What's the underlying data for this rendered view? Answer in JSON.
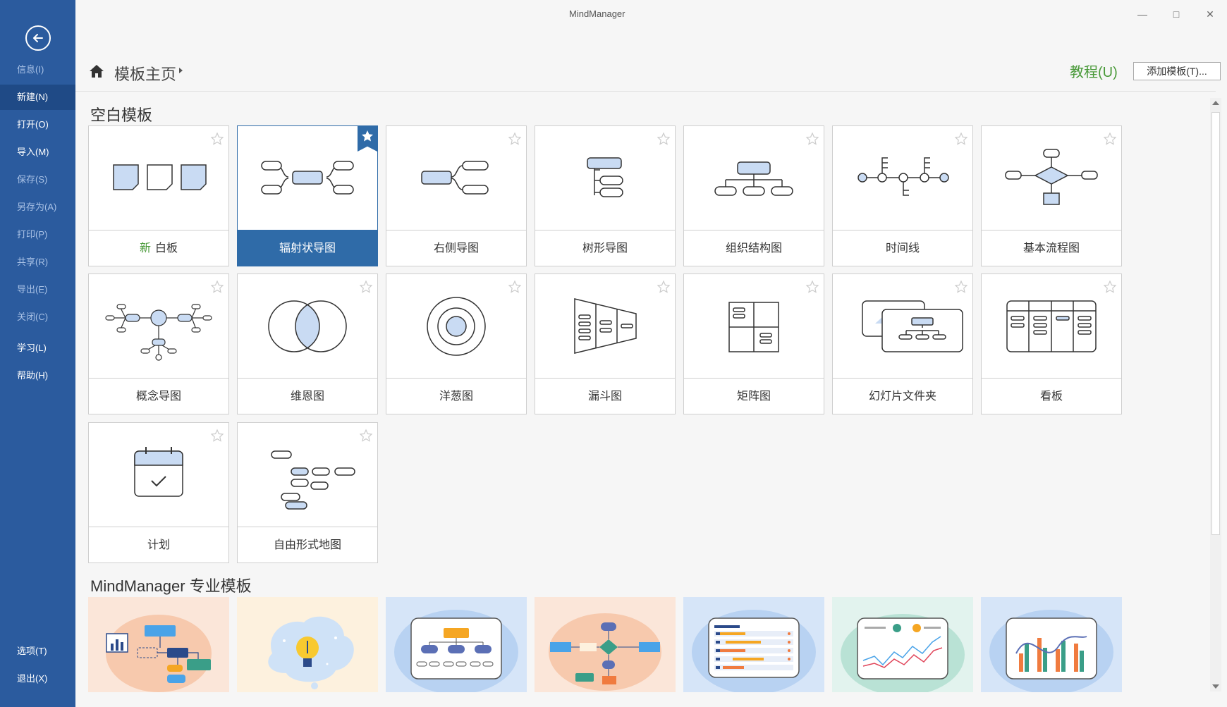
{
  "window": {
    "title": "MindManager",
    "minimize": "—",
    "maximize": "□",
    "close": "✕"
  },
  "sidebar": {
    "back_icon": "arrow-left-circle-icon",
    "items": [
      {
        "label": "信息(I)"
      },
      {
        "label": "新建(N)"
      },
      {
        "label": "打开(O)"
      },
      {
        "label": "导入(M)"
      },
      {
        "label": "保存(S)"
      },
      {
        "label": "另存为(A)"
      },
      {
        "label": "打印(P)"
      },
      {
        "label": "共享(R)"
      },
      {
        "label": "导出(E)"
      },
      {
        "label": "关闭(C)"
      },
      {
        "label": "学习(L)"
      },
      {
        "label": "帮助(H)"
      }
    ],
    "bottom_items": [
      {
        "label": "选项(T)"
      },
      {
        "label": "退出(X)"
      }
    ]
  },
  "header": {
    "home_icon": "home-icon",
    "breadcrumb": "模板主页",
    "tutorial": "教程(U)",
    "add_template": "添加模板(T)..."
  },
  "blank_templates": {
    "title": "空白模板",
    "new_tag": "新",
    "items": [
      {
        "label": "白板",
        "icon": "whiteboard-icon"
      },
      {
        "label": "辐射状导图",
        "icon": "radial-map-icon"
      },
      {
        "label": "右侧导图",
        "icon": "right-map-icon"
      },
      {
        "label": "树形导图",
        "icon": "tree-map-icon"
      },
      {
        "label": "组织结构图",
        "icon": "org-chart-icon"
      },
      {
        "label": "时间线",
        "icon": "timeline-icon"
      },
      {
        "label": "基本流程图",
        "icon": "flowchart-icon"
      },
      {
        "label": "概念导图",
        "icon": "concept-map-icon"
      },
      {
        "label": "维恩图",
        "icon": "venn-icon"
      },
      {
        "label": "洋葱图",
        "icon": "onion-icon"
      },
      {
        "label": "漏斗图",
        "icon": "funnel-icon"
      },
      {
        "label": "矩阵图",
        "icon": "matrix-icon"
      },
      {
        "label": "幻灯片文件夹",
        "icon": "slide-folder-icon"
      },
      {
        "label": "看板",
        "icon": "kanban-icon"
      },
      {
        "label": "计划",
        "icon": "calendar-check-icon"
      },
      {
        "label": "自由形式地图",
        "icon": "freeform-map-icon"
      }
    ]
  },
  "pro_templates": {
    "title": "MindManager 专业模板",
    "items": [
      {
        "icon": "flow-report-illustration",
        "bg": "#f7d3bf"
      },
      {
        "icon": "lightbulb-illustration",
        "bg": "#fcefd9"
      },
      {
        "icon": "org-illustration",
        "bg": "#cfe0f6"
      },
      {
        "icon": "process-flow-illustration",
        "bg": "#f7d3bf"
      },
      {
        "icon": "gantt-illustration",
        "bg": "#cfe0f6"
      },
      {
        "icon": "line-chart-illustration",
        "bg": "#d8efe8"
      },
      {
        "icon": "bar-chart-illustration",
        "bg": "#cfe0f6"
      }
    ]
  },
  "colors": {
    "sidebar": "#2b5b9e",
    "accent": "#2f6ba8",
    "tutorial": "#4a9a3a",
    "icon_fill": "#c9dbf3",
    "icon_stroke": "#333333"
  }
}
